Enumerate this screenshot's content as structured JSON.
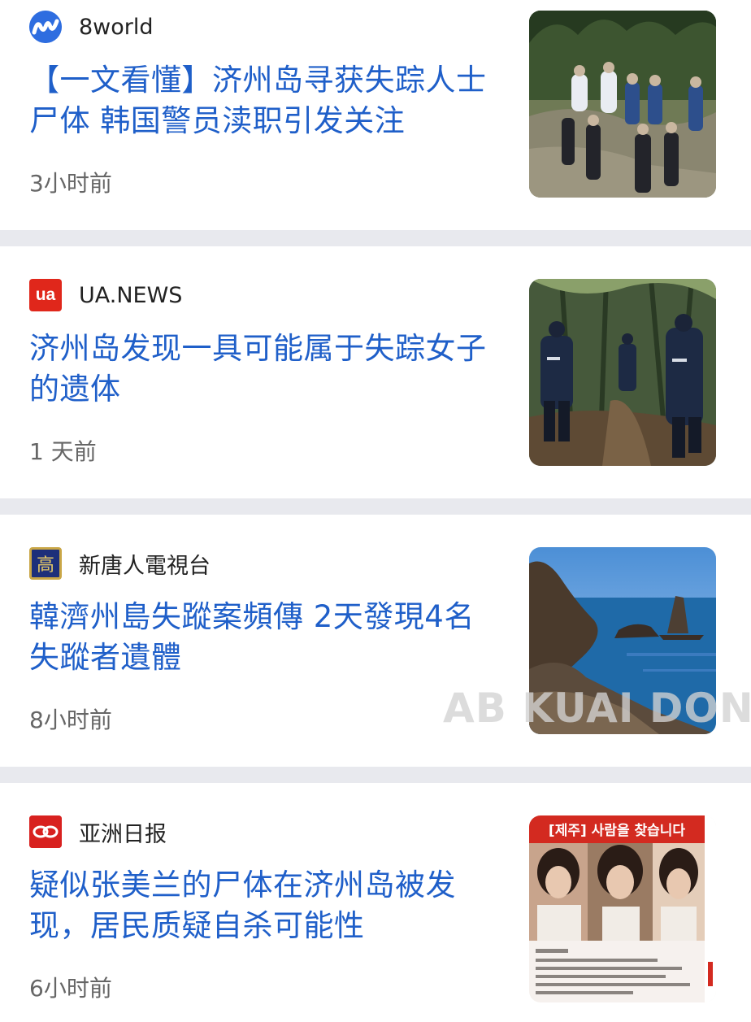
{
  "colors": {
    "headline": "#1f5fc9",
    "source_text": "#222222",
    "time_text": "#666666",
    "separator": "#e8e9ee"
  },
  "articles": [
    {
      "source": "8world",
      "logo_icon": "8world-logo-icon",
      "headline": "【一文看懂】济州岛寻获失踪人士尸体 韩国警员渎职引发关注",
      "time": "3小时前",
      "image": "search-team-photo"
    },
    {
      "source": "UA.NEWS",
      "logo_icon": "ua-news-logo-icon",
      "logo_text": "ua",
      "headline": "济州岛发现一具可能属于失踪女子的遗体",
      "time": "1 天前",
      "image": "forest-police-photo"
    },
    {
      "source": "新唐人電視台",
      "logo_icon": "ntd-logo-icon",
      "logo_text": "高",
      "headline": "韓濟州島失蹤案頻傳 2天發現4名失蹤者遺體",
      "time": "8小时前",
      "image": "coastline-photo"
    },
    {
      "source": "亚洲日报",
      "logo_icon": "asia-daily-logo-icon",
      "headline": "疑似张美兰的尸体在济州岛被发现，居民质疑自杀可能性",
      "time": "6小时前",
      "image": "missing-person-poster",
      "image_text": "[제주] 사람을 찾습니다"
    }
  ],
  "watermark": "AB KUAI DONG"
}
